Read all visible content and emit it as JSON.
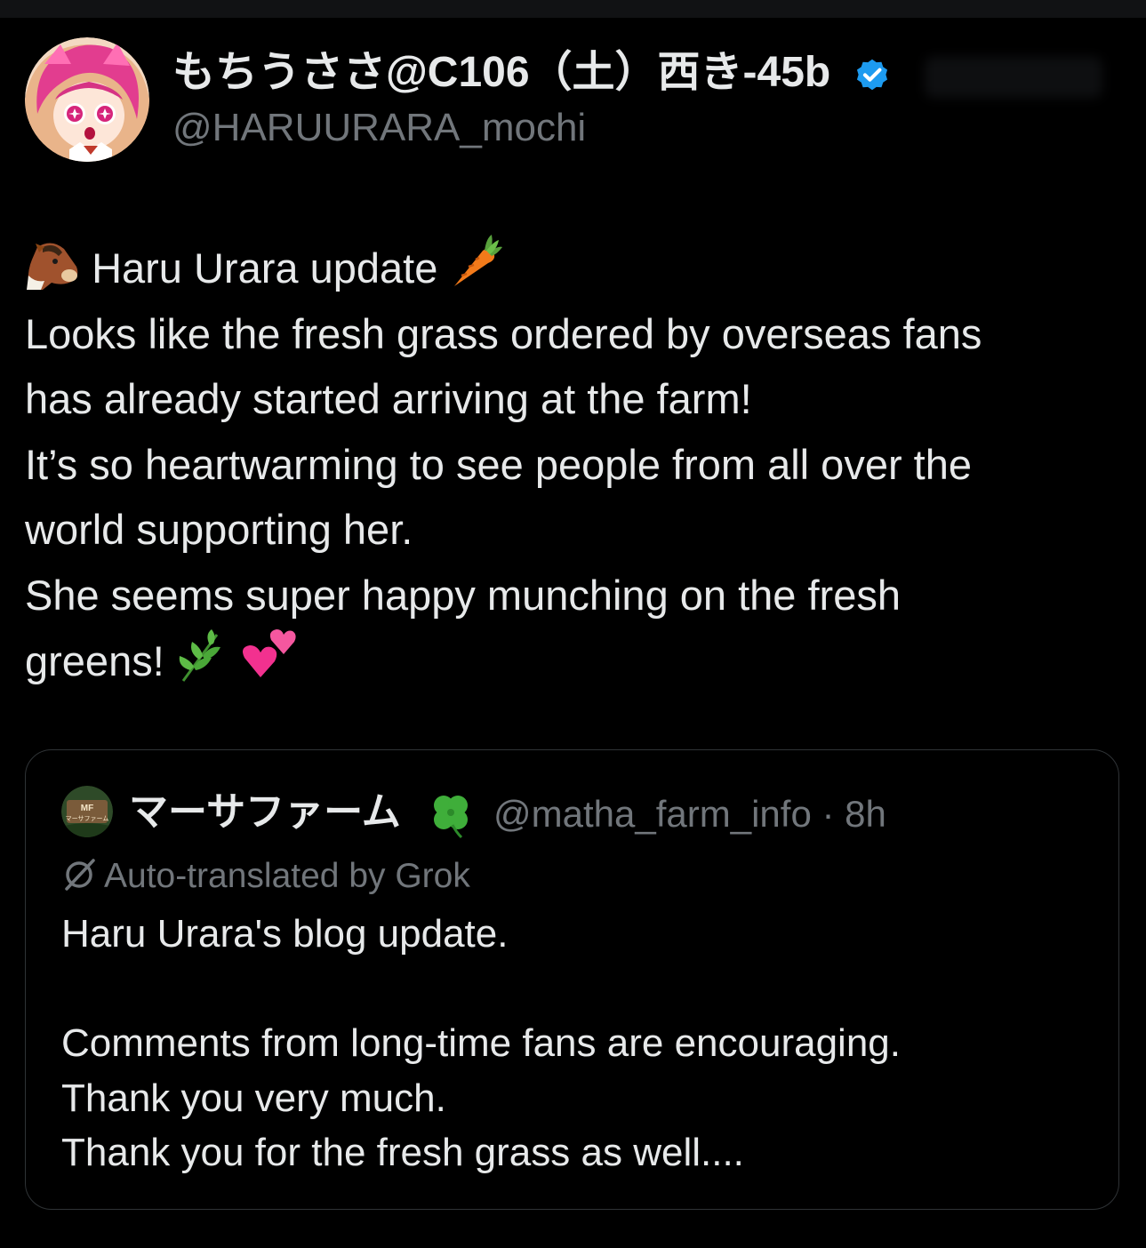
{
  "author": {
    "display_name": "もちうささ@C106（土）西き-45b",
    "handle": "@HARUURARA_mochi",
    "verified": true,
    "avatar_icon": "anime-avatar-pink-hair"
  },
  "post": {
    "lines": [
      "Haru Urara update",
      "Looks like the fresh grass ordered by overseas fans",
      "has already started arriving at the farm!",
      "It’s so heartwarming to see people from all over the",
      "world supporting her.",
      "She seems super happy munching on the fresh",
      "greens!"
    ],
    "emojis": {
      "lead": "horse-face-icon",
      "title_trail": "carrot-icon",
      "end_1": "herb-icon",
      "end_2": "two-hearts-icon"
    }
  },
  "quote": {
    "display_name": "マーサファーム",
    "name_emoji": "four-leaf-clover-icon",
    "handle": "@matha_farm_info",
    "separator": "·",
    "time": "8h",
    "avatar_icon": "farm-logo-avatar",
    "avatar_text": "マーサファーム",
    "translation_note": "Auto-translated by Grok",
    "lines": [
      "Haru Urara's blog update.",
      "",
      "Comments from long-time fans are encouraging.",
      "Thank you very much.",
      "Thank you for the fresh grass as well...."
    ]
  },
  "colors": {
    "background": "#000000",
    "text_primary": "#e7e9ea",
    "text_secondary": "#71767b",
    "border": "#2f3336",
    "verified_blue": "#1d9bf0"
  }
}
